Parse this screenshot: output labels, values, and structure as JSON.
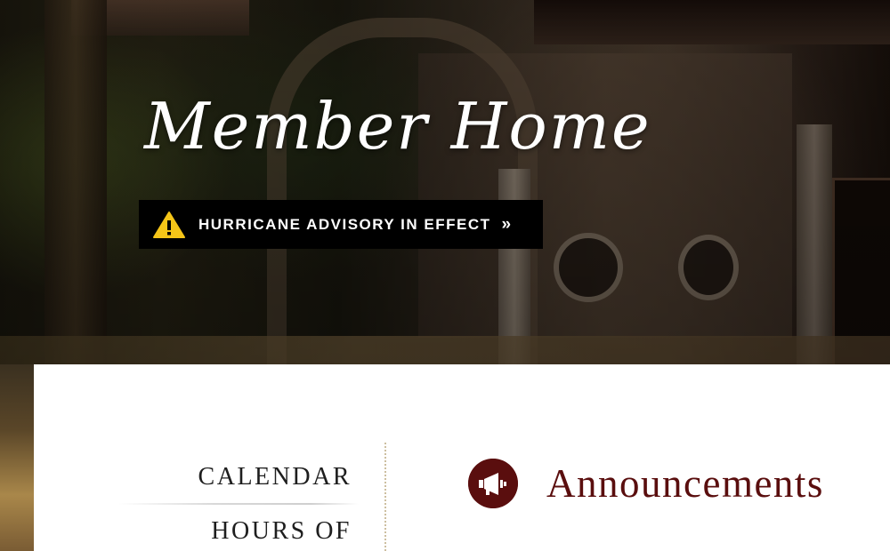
{
  "hero": {
    "title": "Member Home",
    "advisory": {
      "label": "HURRICANE ADVISORY IN EFFECT",
      "arrow": "»",
      "icon": "warning-triangle-icon",
      "icon_color": "#f5c518"
    }
  },
  "side_nav": {
    "items": [
      {
        "label": "CALENDAR"
      },
      {
        "label": "HOURS OF"
      }
    ]
  },
  "announcements": {
    "title": "Announcements",
    "icon": "megaphone-icon",
    "accent_color": "#5a0e0e"
  }
}
